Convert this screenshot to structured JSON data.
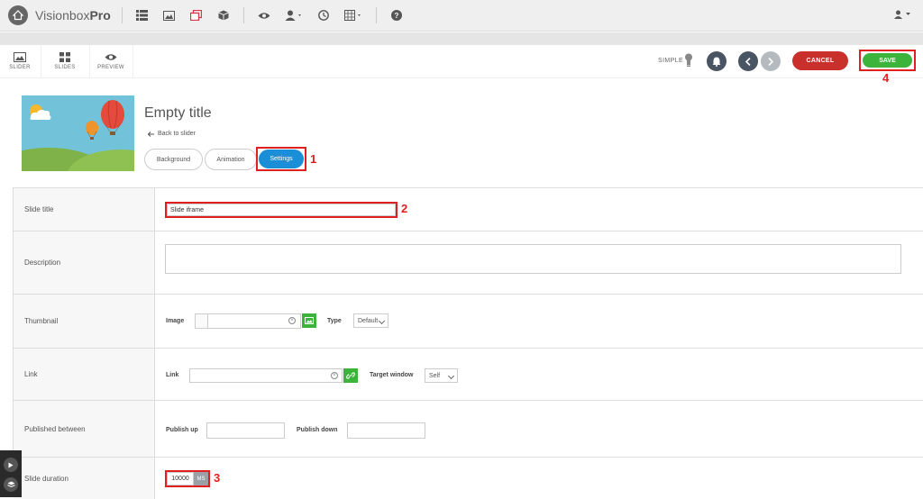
{
  "app": {
    "brand_light": "Visionbox",
    "brand_bold": "Pro"
  },
  "topbar": {
    "icons": [
      "list-icon",
      "image-icon",
      "copy-icon",
      "cube-icon",
      "eye-icon",
      "user-group-icon",
      "clock-icon",
      "grid-icon",
      "help-icon"
    ],
    "user_icon": "user-icon"
  },
  "toolbar": {
    "tools": [
      {
        "label": "SLIDER",
        "icon": "image-icon"
      },
      {
        "label": "SLIDES",
        "icon": "slides-icon"
      },
      {
        "label": "PREVIEW",
        "icon": "eye-icon"
      }
    ],
    "mode_label": "SIMPLE",
    "cancel_label": "CANCEL",
    "save_label": "SAVE"
  },
  "slide": {
    "title": "Empty title",
    "back_label": "Back to slider",
    "tabs": [
      {
        "label": "Background",
        "active": false
      },
      {
        "label": "Animation",
        "active": false
      },
      {
        "label": "Settings",
        "active": true
      }
    ]
  },
  "annotations": [
    "1",
    "2",
    "3",
    "4"
  ],
  "form": {
    "slide_title": {
      "label": "Slide title",
      "value": "Slide iframe"
    },
    "description": {
      "label": "Description",
      "value": ""
    },
    "thumbnail": {
      "label": "Thumbnail",
      "image_label": "Image",
      "type_label": "Type",
      "type_value": "Default"
    },
    "link": {
      "label": "Link",
      "link_label": "Link",
      "target_label": "Target window",
      "target_value": "Self"
    },
    "published": {
      "label": "Published between",
      "up_label": "Publish up",
      "down_label": "Publish down"
    },
    "duration": {
      "label": "Slide duration",
      "value": "10000",
      "unit": "MS"
    }
  },
  "colors": {
    "accent_blue": "#1a8fd8",
    "save_green": "#3cb43c",
    "cancel_red": "#c9302c",
    "annotation_red": "#e02020"
  }
}
